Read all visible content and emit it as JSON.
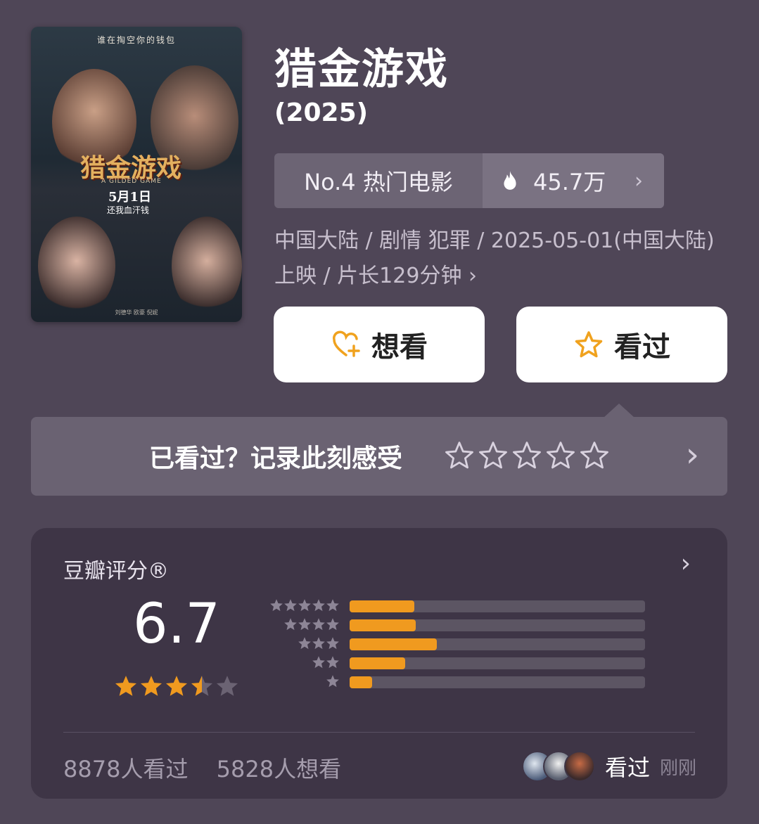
{
  "poster": {
    "tagline": "谁在掏空你的钱包",
    "title": "猎金游戏",
    "subtitle": "A GILDED GAME",
    "date": "5月1日",
    "slogan": "还我血汗钱",
    "credit": "刘德华 欧豪 倪妮"
  },
  "movie": {
    "title": "猎金游戏",
    "year": "(2025)",
    "rank": "No.4 热门电影",
    "heat": "45.7万",
    "meta": "中国大陆 / 剧情 犯罪 / 2025-05-01(中国大陆)上映 / 片长129分钟",
    "meta_chevron": ">"
  },
  "buttons": {
    "want": "想看",
    "seen": "看过"
  },
  "record": {
    "prompt": "已看过？记录此刻感受",
    "star_count": 5
  },
  "rating": {
    "label": "豆瓣评分®",
    "score": "6.7",
    "stars": 3.5,
    "distribution": [
      {
        "stars": 5,
        "percent": 21.8
      },
      {
        "stars": 4,
        "percent": 22.3
      },
      {
        "stars": 3,
        "percent": 29.6
      },
      {
        "stars": 2,
        "percent": 18.7
      },
      {
        "stars": 1,
        "percent": 7.6
      }
    ],
    "seen_count": "8878人看过",
    "want_count": "5828人想看",
    "friend_action": "看过",
    "friend_time": "刚刚"
  },
  "colors": {
    "background": "#4f4657",
    "accent": "#f09a1f",
    "card": "#3e3546"
  }
}
